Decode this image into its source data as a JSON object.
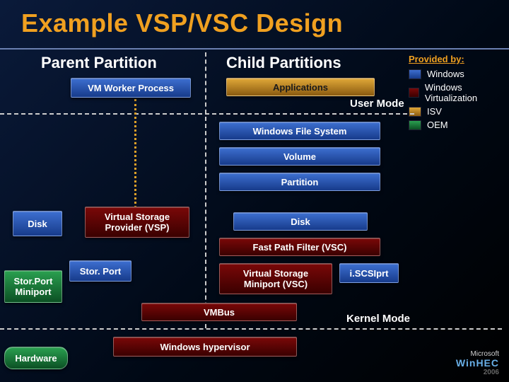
{
  "title": "Example VSP/VSC Design",
  "columns": {
    "parent": "Parent Partition",
    "child": "Child Partitions"
  },
  "legend": {
    "header": "Provided by:",
    "items": [
      {
        "key": "win",
        "label": "Windows"
      },
      {
        "key": "wv",
        "label": "Windows Virtualization"
      },
      {
        "key": "isv",
        "label": "ISV"
      },
      {
        "key": "oem",
        "label": "OEM"
      }
    ]
  },
  "boxes": {
    "vm_worker": "VM Worker Process",
    "applications": "Applications",
    "wfs": "Windows File System",
    "volume": "Volume",
    "partition": "Partition",
    "disk_parent": "Disk",
    "vsp": "Virtual Storage Provider (VSP)",
    "disk_child": "Disk",
    "fpf": "Fast Path Filter (VSC)",
    "storport": "Stor. Port",
    "storport_mini": "Stor.Port Miniport",
    "vs_miniport": "Virtual Storage Miniport (VSC)",
    "iscsi": "i.SCSIprt",
    "vmbus": "VMBus",
    "hypervisor": "Windows hypervisor",
    "hardware": "Hardware"
  },
  "labels": {
    "user_mode": "User Mode",
    "kernel_mode": "Kernel Mode"
  },
  "footer": {
    "ms": "Microsoft",
    "hec": "WinHEC",
    "yr": "2006"
  }
}
